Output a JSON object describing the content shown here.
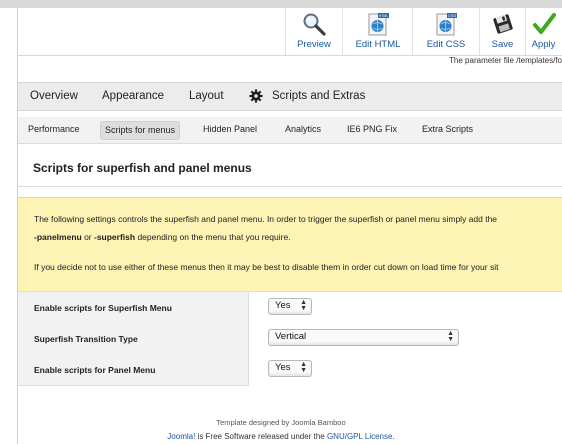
{
  "toolbar": {
    "preview": "Preview",
    "edit_html": "Edit HTML",
    "edit_css": "Edit CSS",
    "save": "Save",
    "apply": "Apply",
    "icon_css_badge": "CSS",
    "icon_html_badge": "HTML"
  },
  "param_info": "The parameter file /templates/fo",
  "main_tabs": [
    "Overview",
    "Appearance",
    "Layout",
    "Scripts and Extras"
  ],
  "sub_tabs": [
    "Performance",
    "Scripts for menus",
    "Hidden Panel",
    "Analytics",
    "IE6 PNG Fix",
    "Extra Scripts"
  ],
  "heading": "Scripts for superfish and panel menus",
  "notice": {
    "line1": "The following settings controls the superfish and panel menu. In order to trigger the superfish or panel menu simply add the",
    "line2_bold1": "-panelmenu",
    "line2_mid": " or ",
    "line2_bold2": "-superfish",
    "line2_end": " depending on the menu that you require.",
    "line3": "If you decide not to use either of these menus then it may be best to disable them in order cut down on load time for your sit"
  },
  "settings": [
    {
      "label": "Enable scripts for Superfish Menu",
      "value": "Yes"
    },
    {
      "label": "Superfish Transition Type",
      "value": "Vertical"
    },
    {
      "label": "Enable scripts for Panel Menu",
      "value": "Yes"
    }
  ],
  "footer": {
    "line1": "Template designed by Joomla Bamboo",
    "joomla": "Joomla!",
    "mid": " is Free Software released under the ",
    "license": "GNU/GPL License",
    "end": "."
  },
  "colors": {
    "link": "#1b57a2",
    "notice_bg": "#fdf3b5",
    "apply_check": "#3ea81f"
  }
}
